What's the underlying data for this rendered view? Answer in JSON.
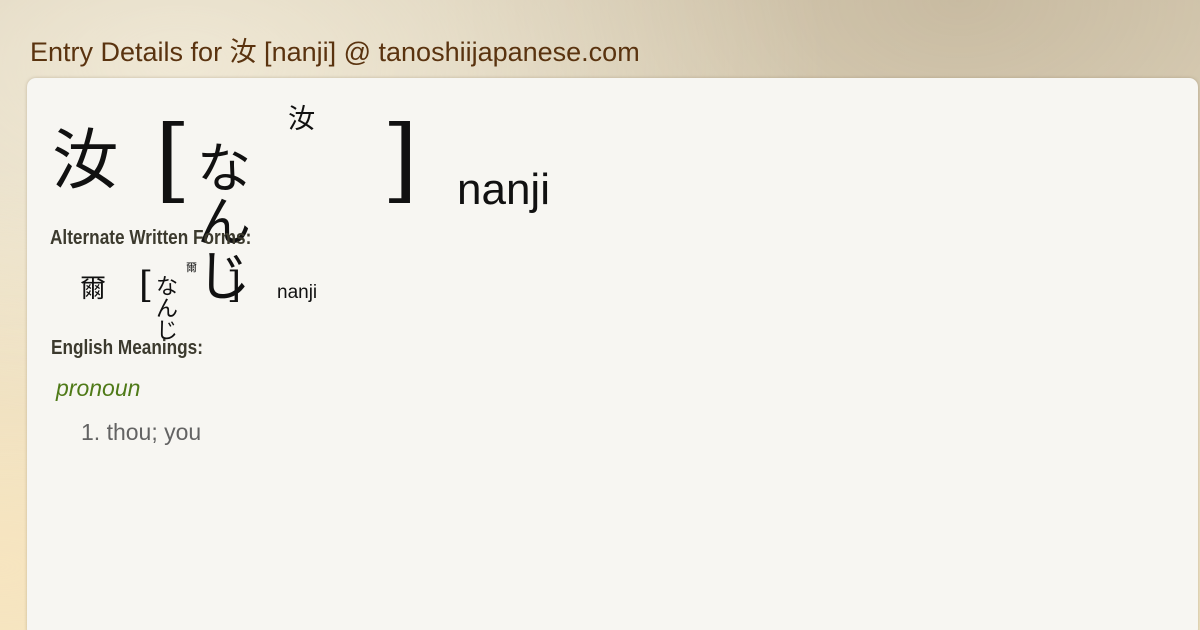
{
  "header": {
    "title": "Entry Details for 汝 [nanji] @ tanoshiijapanese.com"
  },
  "entry": {
    "kanji": "汝",
    "bracket_open": "[",
    "bracket_close": "]",
    "furigana": "汝",
    "kana": "なんじ",
    "romaji": "nanji"
  },
  "alternate": {
    "heading": "Alternate Written Forms:",
    "forms": [
      {
        "kanji": "爾",
        "bracket_open": "[",
        "bracket_close": "]",
        "furigana": "爾",
        "kana": "なんじ",
        "romaji": "nanji"
      }
    ]
  },
  "meanings": {
    "heading": "English Meanings:",
    "part_of_speech": "pronoun",
    "items": [
      {
        "text": "1. thou; you"
      }
    ]
  }
}
